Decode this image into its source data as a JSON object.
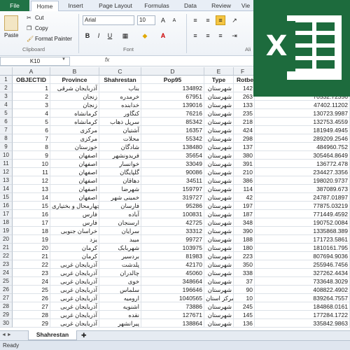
{
  "ribbon": {
    "tabs": [
      "File",
      "Home",
      "Insert",
      "Page Layout",
      "Formulas",
      "Data",
      "Review",
      "Vie"
    ],
    "clipboard": {
      "paste": "Paste",
      "cut": "Cut",
      "copy": "Copy",
      "format_painter": "Format Painter",
      "label": "Clipboard"
    },
    "font": {
      "name": "Arial",
      "size": "10",
      "label": "Font"
    },
    "alignment_label": "Ali"
  },
  "formula_bar": {
    "name_box": "K10",
    "fx": "fx"
  },
  "columns": [
    "A",
    "B",
    "C",
    "D",
    "E",
    "F"
  ],
  "header_row": [
    "OBJECTID",
    "Province",
    "Shahrestan",
    "Pop95",
    "Type",
    "Rotbe"
  ],
  "rows": [
    [
      "1",
      "آذربایجان شرقی",
      "بناب",
      "134892",
      "شهرستان",
      "142",
      "121692.5536"
    ],
    [
      "2",
      "زنجان",
      "خرمدره",
      "67951",
      "شهرستان",
      "263",
      "70532.72356"
    ],
    [
      "3",
      "زنجان",
      "خدابنده",
      "139016",
      "شهرستان",
      "133",
      "47402.11202"
    ],
    [
      "4",
      "کرمانشاه",
      "کنگاور",
      "76216",
      "شهرستان",
      "235",
      "130723.9987"
    ],
    [
      "5",
      "کرمانشاه",
      "سرپل ذهاب",
      "85342",
      "شهرستان",
      "218",
      "132753.4559"
    ],
    [
      "6",
      "مرکزی",
      "آشتیان",
      "16357",
      "شهرستان",
      "424",
      "181949.4945"
    ],
    [
      "7",
      "مرکزی",
      "محلات",
      "55342",
      "شهرستان",
      "298",
      "289209.2546"
    ],
    [
      "8",
      "خوزستان",
      "شادگان",
      "138480",
      "شهرستان",
      "137",
      "484960.752"
    ],
    [
      "9",
      "اصفهان",
      "فریدونشهر",
      "35654",
      "شهرستان",
      "380",
      "305464.8649"
    ],
    [
      "10",
      "اصفهان",
      "خوانسار",
      "33049",
      "شهرستان",
      "391",
      "136772.478"
    ],
    [
      "11",
      "اصفهان",
      "گلپایگان",
      "90086",
      "شهرستان",
      "210",
      "234427.3356"
    ],
    [
      "12",
      "اصفهان",
      "دهاقان",
      "34511",
      "شهرستان",
      "386",
      "198020.9737"
    ],
    [
      "13",
      "اصفهان",
      "شهرضا",
      "159797",
      "شهرستان",
      "114",
      "387089.673"
    ],
    [
      "14",
      "اصفهان",
      "خمینی شهر",
      "319727",
      "شهرستان",
      "42",
      "24787.01897"
    ],
    [
      "15",
      "چهارمحال و بختیاری",
      "فارسان",
      "95286",
      "شهرستان",
      "197",
      "77875.03219"
    ],
    [
      "16",
      "فارس",
      "آباده",
      "100831",
      "شهرستان",
      "187",
      "771449.4592"
    ],
    [
      "17",
      "فارس",
      "ارسنجان",
      "42725",
      "شهرستان",
      "348",
      "190752.0084"
    ],
    [
      "18",
      "خراسان جنوبی",
      "سرایان",
      "33312",
      "شهرستان",
      "390",
      "1335868.389"
    ],
    [
      "19",
      "یزد",
      "میبد",
      "99727",
      "شهرستان",
      "188",
      "171723.5861"
    ],
    [
      "20",
      "کرمان",
      "شهربابک",
      "103975",
      "شهرستان",
      "180",
      "1810161.795"
    ],
    [
      "21",
      "کرمان",
      "بردسیر",
      "81983",
      "شهرستان",
      "223",
      "807694.9036"
    ],
    [
      "22",
      "آذربایجان غربی",
      "پلدشت",
      "42170",
      "شهرستان",
      "350",
      "255946.7456"
    ],
    [
      "23",
      "آذربایجان غربی",
      "چالدران",
      "45060",
      "شهرستان",
      "338",
      "327262.4434"
    ],
    [
      "24",
      "آذربایجان غربی",
      "خوی",
      "348664",
      "شهرستان",
      "37",
      "733648.3029"
    ],
    [
      "25",
      "آذربایجان غربی",
      "سلماس",
      "196646",
      "شهرستان",
      "90",
      "408822.4902"
    ],
    [
      "26",
      "آذربایجان غربی",
      "ارومیه",
      "1040565",
      "مرکز استان",
      "10",
      "839264.7557"
    ],
    [
      "27",
      "آذربایجان غربی",
      "اشنویه",
      "73886",
      "شهرستان",
      "245",
      "184868.0161"
    ],
    [
      "28",
      "آذربایجان غربی",
      "نقده",
      "127671",
      "شهرستان",
      "145",
      "177284.1722"
    ],
    [
      "29",
      "آذربایجان غربی",
      "پیرانشهر",
      "138864",
      "شهرستان",
      "136",
      "335842.9863"
    ]
  ],
  "sheet_tab": "Shahrestan",
  "status": "Ready",
  "colors": {
    "excel_green": "#1d6b3d",
    "file_tab": "#217346"
  }
}
